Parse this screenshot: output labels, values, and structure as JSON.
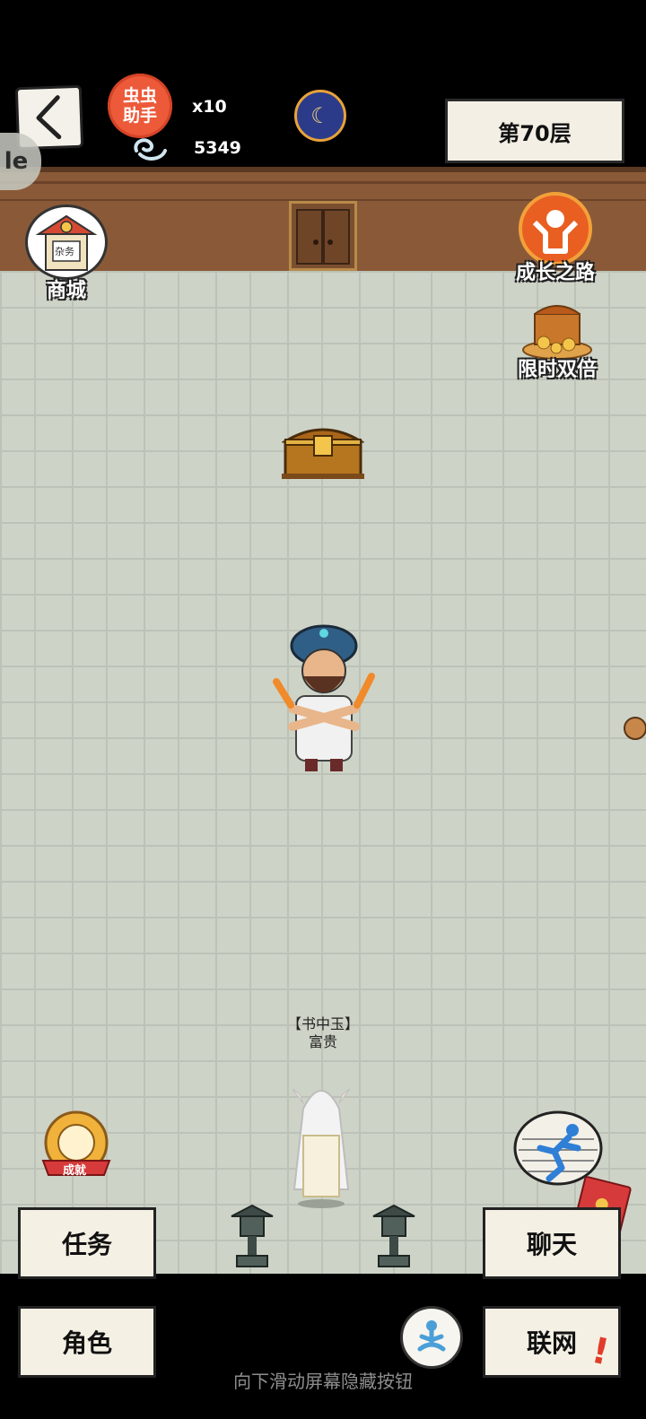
{
  "hud": {
    "helper_label": "虫虫\n助手",
    "helper_count": "x10",
    "spirit_count": "5349",
    "floor_label": "第70层"
  },
  "left_menu": {
    "shop_label": "商城",
    "shop_sign": "杂务"
  },
  "right_menu": {
    "growth_label": "成长之路",
    "double_label": "限时双倍"
  },
  "npc": {
    "title": "【书中玉】",
    "name": "富贵"
  },
  "achievement_label": "成就",
  "bottom": {
    "task": "任务",
    "chat": "聊天",
    "role": "角色",
    "network": "联网",
    "alert": "!",
    "hint": "向下滑动屏幕隐藏按钮"
  },
  "colors": {
    "floor": "#b9bfb3",
    "wall": "#8a5a38",
    "helper": "#ec5a3a",
    "button_bg": "#f4f0e4"
  },
  "icons": [
    "back-arrow-icon",
    "helper-icon",
    "spirit-icon",
    "moon-icon",
    "shop-icon",
    "growth-icon",
    "treasure-icon",
    "chest-icon",
    "achievement-icon",
    "run-icon",
    "red-packet-icon",
    "meditate-icon",
    "lantern-icon"
  ]
}
